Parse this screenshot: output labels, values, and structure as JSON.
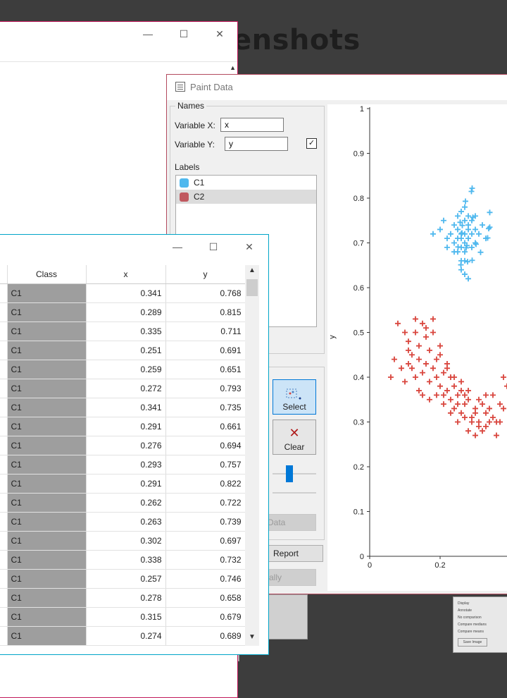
{
  "background": {
    "title": "enshots"
  },
  "window_back": {
    "minimize": "—",
    "maximize": "☐",
    "close": "✕",
    "scroll_up": "▲"
  },
  "paint": {
    "title": "Paint Data",
    "names_group": "Names",
    "var_x_label": "Variable X:",
    "var_x_value": "x",
    "var_y_label": "Variable Y:",
    "var_y_value": "y",
    "labels_heading": "Labels",
    "labels": [
      {
        "name": "C1",
        "color": "#4fb8ee"
      },
      {
        "name": "C2",
        "color": "#c0585f"
      }
    ],
    "tools": {
      "select": "Select",
      "clear": "Clear"
    },
    "data_btn": "Data",
    "report_btn": "Report",
    "auto_btn": "tically"
  },
  "chart_data": {
    "type": "scatter",
    "ylabel": "y",
    "xlim": [
      0,
      0.44
    ],
    "ylim": [
      0,
      1
    ],
    "x_ticks": [
      "0",
      "0.2"
    ],
    "y_ticks": [
      "0",
      "0.1",
      "0.2",
      "0.3",
      "0.4",
      "0.5",
      "0.6",
      "0.7",
      "0.8",
      "0.9",
      "1"
    ],
    "series": [
      {
        "name": "C1",
        "color": "#4fb8ee",
        "points": [
          [
            0.341,
            0.768
          ],
          [
            0.289,
            0.815
          ],
          [
            0.335,
            0.711
          ],
          [
            0.251,
            0.691
          ],
          [
            0.259,
            0.651
          ],
          [
            0.272,
            0.793
          ],
          [
            0.341,
            0.735
          ],
          [
            0.291,
            0.661
          ],
          [
            0.276,
            0.694
          ],
          [
            0.293,
            0.757
          ],
          [
            0.291,
            0.822
          ],
          [
            0.262,
            0.722
          ],
          [
            0.263,
            0.739
          ],
          [
            0.302,
            0.697
          ],
          [
            0.338,
            0.732
          ],
          [
            0.257,
            0.746
          ],
          [
            0.278,
            0.658
          ],
          [
            0.315,
            0.679
          ],
          [
            0.274,
            0.689
          ],
          [
            0.26,
            0.72
          ],
          [
            0.27,
            0.75
          ],
          [
            0.28,
            0.71
          ],
          [
            0.25,
            0.73
          ],
          [
            0.27,
            0.68
          ],
          [
            0.29,
            0.72
          ],
          [
            0.24,
            0.7
          ],
          [
            0.26,
            0.69
          ],
          [
            0.28,
            0.74
          ],
          [
            0.3,
            0.73
          ],
          [
            0.25,
            0.76
          ],
          [
            0.27,
            0.66
          ],
          [
            0.26,
            0.64
          ],
          [
            0.28,
            0.62
          ],
          [
            0.27,
            0.63
          ],
          [
            0.29,
            0.75
          ],
          [
            0.23,
            0.72
          ],
          [
            0.22,
            0.71
          ],
          [
            0.24,
            0.68
          ],
          [
            0.3,
            0.7
          ],
          [
            0.31,
            0.72
          ],
          [
            0.32,
            0.74
          ],
          [
            0.26,
            0.77
          ],
          [
            0.27,
            0.78
          ],
          [
            0.28,
            0.76
          ],
          [
            0.25,
            0.71
          ],
          [
            0.26,
            0.66
          ],
          [
            0.27,
            0.72
          ],
          [
            0.29,
            0.69
          ],
          [
            0.3,
            0.76
          ],
          [
            0.33,
            0.71
          ],
          [
            0.2,
            0.73
          ],
          [
            0.18,
            0.72
          ],
          [
            0.21,
            0.75
          ],
          [
            0.22,
            0.69
          ],
          [
            0.27,
            0.7
          ],
          [
            0.26,
            0.71
          ],
          [
            0.28,
            0.73
          ],
          [
            0.24,
            0.74
          ],
          [
            0.25,
            0.68
          ]
        ]
      },
      {
        "name": "C2",
        "color": "#d9463e",
        "points": [
          [
            0.07,
            0.44
          ],
          [
            0.08,
            0.52
          ],
          [
            0.1,
            0.5
          ],
          [
            0.11,
            0.48
          ],
          [
            0.12,
            0.45
          ],
          [
            0.13,
            0.5
          ],
          [
            0.14,
            0.47
          ],
          [
            0.15,
            0.52
          ],
          [
            0.16,
            0.49
          ],
          [
            0.17,
            0.46
          ],
          [
            0.18,
            0.5
          ],
          [
            0.19,
            0.44
          ],
          [
            0.2,
            0.45
          ],
          [
            0.21,
            0.41
          ],
          [
            0.22,
            0.43
          ],
          [
            0.23,
            0.4
          ],
          [
            0.24,
            0.38
          ],
          [
            0.25,
            0.36
          ],
          [
            0.26,
            0.37
          ],
          [
            0.27,
            0.34
          ],
          [
            0.28,
            0.35
          ],
          [
            0.29,
            0.31
          ],
          [
            0.3,
            0.33
          ],
          [
            0.31,
            0.3
          ],
          [
            0.32,
            0.34
          ],
          [
            0.33,
            0.32
          ],
          [
            0.34,
            0.33
          ],
          [
            0.35,
            0.36
          ],
          [
            0.36,
            0.3
          ],
          [
            0.37,
            0.34
          ],
          [
            0.38,
            0.4
          ],
          [
            0.39,
            0.38
          ],
          [
            0.12,
            0.42
          ],
          [
            0.13,
            0.4
          ],
          [
            0.14,
            0.44
          ],
          [
            0.15,
            0.41
          ],
          [
            0.16,
            0.43
          ],
          [
            0.17,
            0.39
          ],
          [
            0.18,
            0.42
          ],
          [
            0.19,
            0.4
          ],
          [
            0.2,
            0.38
          ],
          [
            0.21,
            0.36
          ],
          [
            0.22,
            0.37
          ],
          [
            0.23,
            0.35
          ],
          [
            0.24,
            0.33
          ],
          [
            0.25,
            0.34
          ],
          [
            0.26,
            0.32
          ],
          [
            0.27,
            0.31
          ],
          [
            0.28,
            0.28
          ],
          [
            0.29,
            0.3
          ],
          [
            0.3,
            0.27
          ],
          [
            0.31,
            0.29
          ],
          [
            0.33,
            0.29
          ],
          [
            0.35,
            0.31
          ],
          [
            0.36,
            0.27
          ],
          [
            0.06,
            0.4
          ],
          [
            0.09,
            0.42
          ],
          [
            0.1,
            0.39
          ],
          [
            0.11,
            0.43
          ],
          [
            0.14,
            0.37
          ],
          [
            0.15,
            0.36
          ],
          [
            0.17,
            0.35
          ],
          [
            0.19,
            0.36
          ],
          [
            0.21,
            0.34
          ],
          [
            0.23,
            0.32
          ],
          [
            0.25,
            0.3
          ],
          [
            0.27,
            0.36
          ],
          [
            0.3,
            0.32
          ],
          [
            0.32,
            0.28
          ],
          [
            0.34,
            0.3
          ],
          [
            0.37,
            0.3
          ],
          [
            0.38,
            0.33
          ],
          [
            0.16,
            0.51
          ],
          [
            0.18,
            0.53
          ],
          [
            0.2,
            0.47
          ],
          [
            0.13,
            0.53
          ],
          [
            0.11,
            0.46
          ],
          [
            0.22,
            0.42
          ],
          [
            0.24,
            0.4
          ],
          [
            0.26,
            0.39
          ],
          [
            0.28,
            0.37
          ],
          [
            0.31,
            0.35
          ],
          [
            0.33,
            0.36
          ]
        ]
      }
    ]
  },
  "table": {
    "window_controls": {
      "minimize": "—",
      "maximize": "☐",
      "close": "✕"
    },
    "columns": [
      "Class",
      "x",
      "y"
    ],
    "rows": [
      [
        "C1",
        "0.341",
        "0.768"
      ],
      [
        "C1",
        "0.289",
        "0.815"
      ],
      [
        "C1",
        "0.335",
        "0.711"
      ],
      [
        "C1",
        "0.251",
        "0.691"
      ],
      [
        "C1",
        "0.259",
        "0.651"
      ],
      [
        "C1",
        "0.272",
        "0.793"
      ],
      [
        "C1",
        "0.341",
        "0.735"
      ],
      [
        "C1",
        "0.291",
        "0.661"
      ],
      [
        "C1",
        "0.276",
        "0.694"
      ],
      [
        "C1",
        "0.293",
        "0.757"
      ],
      [
        "C1",
        "0.291",
        "0.822"
      ],
      [
        "C1",
        "0.262",
        "0.722"
      ],
      [
        "C1",
        "0.263",
        "0.739"
      ],
      [
        "C1",
        "0.302",
        "0.697"
      ],
      [
        "C1",
        "0.338",
        "0.732"
      ],
      [
        "C1",
        "0.257",
        "0.746"
      ],
      [
        "C1",
        "0.278",
        "0.658"
      ],
      [
        "C1",
        "0.315",
        "0.679"
      ],
      [
        "C1",
        "0.274",
        "0.689"
      ]
    ],
    "scroll_up": "▲",
    "scroll_down": "▼"
  },
  "bg_widget": {
    "items": [
      "Display",
      "Annotate",
      "No comparison",
      "Compare medians",
      "Compare means"
    ],
    "button": "Save Image"
  }
}
